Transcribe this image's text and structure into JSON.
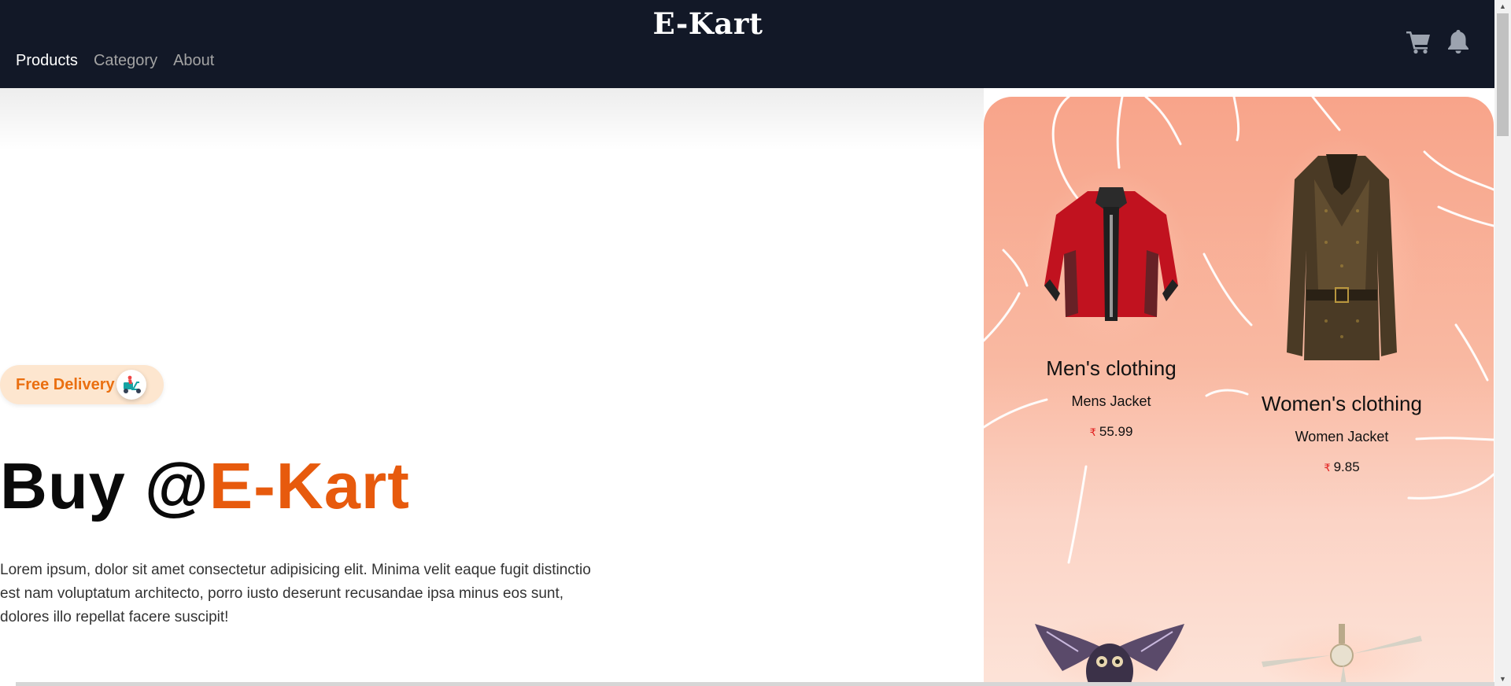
{
  "app": {
    "brand": "E-Kart"
  },
  "nav": {
    "items": [
      {
        "label": "Products",
        "active": true
      },
      {
        "label": "Category",
        "active": false
      },
      {
        "label": "About",
        "active": false
      }
    ]
  },
  "header_icons": [
    "cart-icon",
    "bell-icon"
  ],
  "hero": {
    "badge": "Free Delivery",
    "badge_icon": "delivery-scooter-icon",
    "headline_prefix": "Buy @",
    "headline_accent": "E-Kart",
    "description": "Lorem ipsum, dolor sit amet consectetur adipisicing elit. Minima velit eaque fugit distinctio est nam voluptatum architecto, porro iusto deserunt recusandae ipsa minus eos sunt, dolores illo repellat facere suscipit!"
  },
  "products": [
    {
      "category": "Men's clothing",
      "name": "Mens Jacket",
      "currency": "₹",
      "price": "55.99",
      "image": "red-jacket"
    },
    {
      "category": "Women's clothing",
      "name": "Women Jacket",
      "currency": "₹",
      "price": "9.85",
      "image": "brown-leather-jacket"
    },
    {
      "image": "owl-artwork"
    },
    {
      "image": "ceiling-fan"
    }
  ],
  "colors": {
    "header_bg": "#121827",
    "accent": "#e75a0d",
    "badge_bg": "#fde6cf",
    "badge_text": "#ea6f10",
    "panel_top": "#f8a48a",
    "panel_bottom": "#fde4d9",
    "price_currency": "#e11d1d"
  }
}
